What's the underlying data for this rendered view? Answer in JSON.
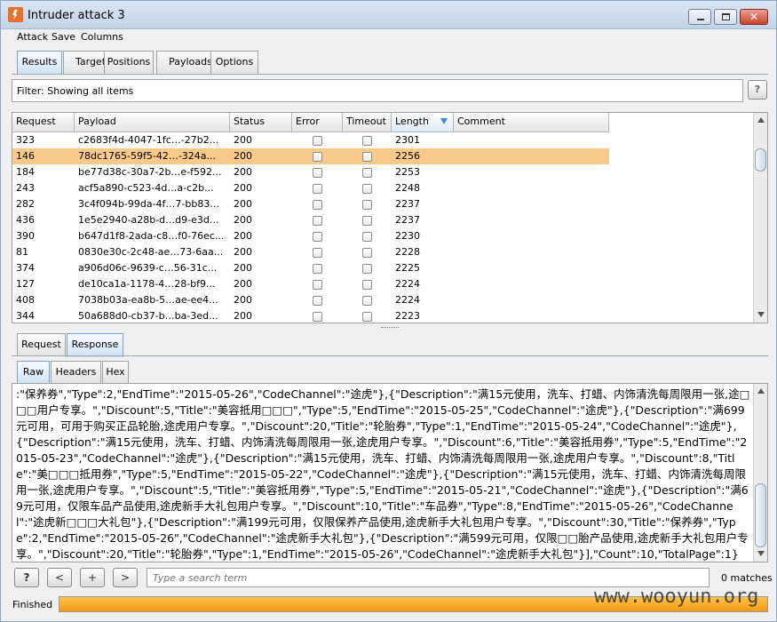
{
  "window": {
    "title": "Intruder attack 3"
  },
  "menu": [
    "Attack",
    "Save",
    "Columns"
  ],
  "main_tabs": [
    {
      "label": "Results",
      "active": true
    },
    {
      "label": "Target",
      "active": false
    },
    {
      "label": "Positions",
      "active": false
    },
    {
      "label": "Payloads",
      "active": false
    },
    {
      "label": "Options",
      "active": false
    }
  ],
  "filter": {
    "text": "Filter:  Showing all items",
    "help": "?"
  },
  "results": {
    "columns": [
      "Request",
      "Payload",
      "Status",
      "Error",
      "Timeout",
      "Length",
      "Comment"
    ],
    "sorted_column": "Length",
    "rows": [
      {
        "request": "323",
        "payload": "c2683f4d-4047-1fc…-27b2...",
        "status": "200",
        "error": false,
        "timeout": false,
        "length": "2301",
        "selected": false
      },
      {
        "request": "146",
        "payload": "78dc1765-59f5-42…-324a...",
        "status": "200",
        "error": false,
        "timeout": false,
        "length": "2256",
        "selected": true
      },
      {
        "request": "184",
        "payload": "be77d38c-30a7-2b…e-f592...",
        "status": "200",
        "error": false,
        "timeout": false,
        "length": "2253",
        "selected": false
      },
      {
        "request": "243",
        "payload": "acf5a890-c523-4d…a-c2b...",
        "status": "200",
        "error": false,
        "timeout": false,
        "length": "2248",
        "selected": false
      },
      {
        "request": "282",
        "payload": "3c4f094b-99da-4f…7-bb83...",
        "status": "200",
        "error": false,
        "timeout": false,
        "length": "2237",
        "selected": false
      },
      {
        "request": "436",
        "payload": "1e5e2940-a28b-d…d9-e3d...",
        "status": "200",
        "error": false,
        "timeout": false,
        "length": "2237",
        "selected": false
      },
      {
        "request": "390",
        "payload": "b647d1f8-2ada-c8…f0-76ec...",
        "status": "200",
        "error": false,
        "timeout": false,
        "length": "2230",
        "selected": false
      },
      {
        "request": "81",
        "payload": "0830e30c-2c48-ae…73-6aa...",
        "status": "200",
        "error": false,
        "timeout": false,
        "length": "2228",
        "selected": false
      },
      {
        "request": "374",
        "payload": "a906d06c-9639-c…56-31c...",
        "status": "200",
        "error": false,
        "timeout": false,
        "length": "2225",
        "selected": false
      },
      {
        "request": "127",
        "payload": "de10ca1a-1178-4…28-bf9...",
        "status": "200",
        "error": false,
        "timeout": false,
        "length": "2224",
        "selected": false
      },
      {
        "request": "408",
        "payload": "7038b03a-ea8b-5…ae-ee4...",
        "status": "200",
        "error": false,
        "timeout": false,
        "length": "2224",
        "selected": false
      },
      {
        "request": "344",
        "payload": "50a688d0-cb37-b…ba-3ed...",
        "status": "200",
        "error": false,
        "timeout": false,
        "length": "2223",
        "selected": false
      }
    ]
  },
  "detail_tabs": [
    {
      "label": "Request",
      "active": false
    },
    {
      "label": "Response",
      "active": true
    }
  ],
  "view_tabs": [
    {
      "label": "Raw",
      "active": true
    },
    {
      "label": "Headers",
      "active": false
    },
    {
      "label": "Hex",
      "active": false
    }
  ],
  "response_body": ":\"保养券\",\"Type\":2,\"EndTime\":\"2015-05-26\",\"CodeChannel\":\"途虎\"},{\"Description\":\"满15元使用，洗车、打蜡、内饰清洗每周限用一张,途□□□用户专享。\",\"Discount\":5,\"Title\":\"美容抵用□□□\",\"Type\":5,\"EndTime\":\"2015-05-25\",\"CodeChannel\":\"途虎\"},{\"Description\":\"满699元可用，可用于购买正品轮胎,途虎用户专享。\",\"Discount\":20,\"Title\":\"轮胎券\",\"Type\":1,\"EndTime\":\"2015-05-24\",\"CodeChannel\":\"途虎\"},{\"Description\":\"满15元使用，洗车、打蜡、内饰清洗每周限用一张,途虎用户专享。\",\"Discount\":6,\"Title\":\"美容抵用券\",\"Type\":5,\"EndTime\":\"2015-05-23\",\"CodeChannel\":\"途虎\"},{\"Description\":\"满15元使用，洗车、打蜡、内饰清洗每周限用一张,途虎用户专享。\",\"Discount\":8,\"Title\":\"美□□□抵用券\",\"Type\":5,\"EndTime\":\"2015-05-22\",\"CodeChannel\":\"途虎\"},{\"Description\":\"满15元使用，洗车、打蜡、内饰清洗每周限用一张,途虎用户专享。\",\"Discount\":5,\"Title\":\"美容抵用券\",\"Type\":5,\"EndTime\":\"2015-05-21\",\"CodeChannel\":\"途虎\"},{\"Description\":\"满69元可用，仅限车品产品使用,途虎新手大礼包用户专享。\",\"Discount\":10,\"Title\":\"车品券\",\"Type\":8,\"EndTime\":\"2015-05-26\",\"CodeChannel\":\"途虎新□□□大礼包\"},{\"Description\":\"满199元可用，仅限保养产品使用,途虎新手大礼包用户专享。\",\"Discount\":30,\"Title\":\"保养券\",\"Type\":2,\"EndTime\":\"2015-05-26\",\"CodeChannel\":\"途虎新手大礼包\"},{\"Description\":\"满599元可用，仅限□□胎产品使用,途虎新手大礼包用户专享。\",\"Discount\":20,\"Title\":\"轮胎券\",\"Type\":1,\"EndTime\":\"2015-05-26\",\"CodeChannel\":\"途虎新手大礼包\"}],\"Count\":10,\"TotalPage\":1}",
  "search": {
    "placeholder": "Type a search term",
    "help": "?",
    "prev": "<",
    "add": "+",
    "next": ">",
    "matches": "0 matches"
  },
  "status": {
    "label": "Finished",
    "progress": 1.0
  },
  "watermark": "www.wooyun.org",
  "colors": {
    "selected_row": "#f7c98a",
    "progress": "#f5a623",
    "active_tab": "#cfe2f4"
  }
}
